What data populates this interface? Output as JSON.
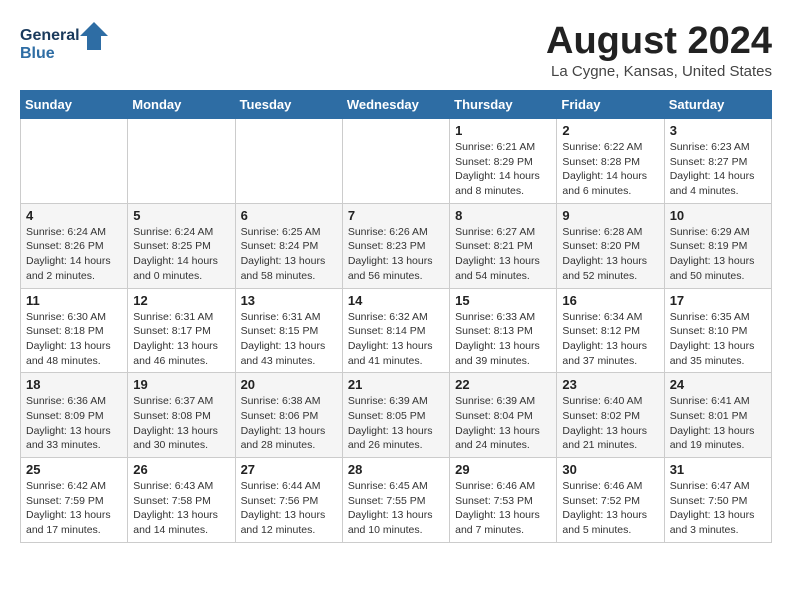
{
  "header": {
    "logo_line1": "General",
    "logo_line2": "Blue",
    "title": "August 2024",
    "subtitle": "La Cygne, Kansas, United States"
  },
  "days_of_week": [
    "Sunday",
    "Monday",
    "Tuesday",
    "Wednesday",
    "Thursday",
    "Friday",
    "Saturday"
  ],
  "weeks": [
    [
      {
        "num": "",
        "info": ""
      },
      {
        "num": "",
        "info": ""
      },
      {
        "num": "",
        "info": ""
      },
      {
        "num": "",
        "info": ""
      },
      {
        "num": "1",
        "info": "Sunrise: 6:21 AM\nSunset: 8:29 PM\nDaylight: 14 hours and 8 minutes."
      },
      {
        "num": "2",
        "info": "Sunrise: 6:22 AM\nSunset: 8:28 PM\nDaylight: 14 hours and 6 minutes."
      },
      {
        "num": "3",
        "info": "Sunrise: 6:23 AM\nSunset: 8:27 PM\nDaylight: 14 hours and 4 minutes."
      }
    ],
    [
      {
        "num": "4",
        "info": "Sunrise: 6:24 AM\nSunset: 8:26 PM\nDaylight: 14 hours and 2 minutes."
      },
      {
        "num": "5",
        "info": "Sunrise: 6:24 AM\nSunset: 8:25 PM\nDaylight: 14 hours and 0 minutes."
      },
      {
        "num": "6",
        "info": "Sunrise: 6:25 AM\nSunset: 8:24 PM\nDaylight: 13 hours and 58 minutes."
      },
      {
        "num": "7",
        "info": "Sunrise: 6:26 AM\nSunset: 8:23 PM\nDaylight: 13 hours and 56 minutes."
      },
      {
        "num": "8",
        "info": "Sunrise: 6:27 AM\nSunset: 8:21 PM\nDaylight: 13 hours and 54 minutes."
      },
      {
        "num": "9",
        "info": "Sunrise: 6:28 AM\nSunset: 8:20 PM\nDaylight: 13 hours and 52 minutes."
      },
      {
        "num": "10",
        "info": "Sunrise: 6:29 AM\nSunset: 8:19 PM\nDaylight: 13 hours and 50 minutes."
      }
    ],
    [
      {
        "num": "11",
        "info": "Sunrise: 6:30 AM\nSunset: 8:18 PM\nDaylight: 13 hours and 48 minutes."
      },
      {
        "num": "12",
        "info": "Sunrise: 6:31 AM\nSunset: 8:17 PM\nDaylight: 13 hours and 46 minutes."
      },
      {
        "num": "13",
        "info": "Sunrise: 6:31 AM\nSunset: 8:15 PM\nDaylight: 13 hours and 43 minutes."
      },
      {
        "num": "14",
        "info": "Sunrise: 6:32 AM\nSunset: 8:14 PM\nDaylight: 13 hours and 41 minutes."
      },
      {
        "num": "15",
        "info": "Sunrise: 6:33 AM\nSunset: 8:13 PM\nDaylight: 13 hours and 39 minutes."
      },
      {
        "num": "16",
        "info": "Sunrise: 6:34 AM\nSunset: 8:12 PM\nDaylight: 13 hours and 37 minutes."
      },
      {
        "num": "17",
        "info": "Sunrise: 6:35 AM\nSunset: 8:10 PM\nDaylight: 13 hours and 35 minutes."
      }
    ],
    [
      {
        "num": "18",
        "info": "Sunrise: 6:36 AM\nSunset: 8:09 PM\nDaylight: 13 hours and 33 minutes."
      },
      {
        "num": "19",
        "info": "Sunrise: 6:37 AM\nSunset: 8:08 PM\nDaylight: 13 hours and 30 minutes."
      },
      {
        "num": "20",
        "info": "Sunrise: 6:38 AM\nSunset: 8:06 PM\nDaylight: 13 hours and 28 minutes."
      },
      {
        "num": "21",
        "info": "Sunrise: 6:39 AM\nSunset: 8:05 PM\nDaylight: 13 hours and 26 minutes."
      },
      {
        "num": "22",
        "info": "Sunrise: 6:39 AM\nSunset: 8:04 PM\nDaylight: 13 hours and 24 minutes."
      },
      {
        "num": "23",
        "info": "Sunrise: 6:40 AM\nSunset: 8:02 PM\nDaylight: 13 hours and 21 minutes."
      },
      {
        "num": "24",
        "info": "Sunrise: 6:41 AM\nSunset: 8:01 PM\nDaylight: 13 hours and 19 minutes."
      }
    ],
    [
      {
        "num": "25",
        "info": "Sunrise: 6:42 AM\nSunset: 7:59 PM\nDaylight: 13 hours and 17 minutes."
      },
      {
        "num": "26",
        "info": "Sunrise: 6:43 AM\nSunset: 7:58 PM\nDaylight: 13 hours and 14 minutes."
      },
      {
        "num": "27",
        "info": "Sunrise: 6:44 AM\nSunset: 7:56 PM\nDaylight: 13 hours and 12 minutes."
      },
      {
        "num": "28",
        "info": "Sunrise: 6:45 AM\nSunset: 7:55 PM\nDaylight: 13 hours and 10 minutes."
      },
      {
        "num": "29",
        "info": "Sunrise: 6:46 AM\nSunset: 7:53 PM\nDaylight: 13 hours and 7 minutes."
      },
      {
        "num": "30",
        "info": "Sunrise: 6:46 AM\nSunset: 7:52 PM\nDaylight: 13 hours and 5 minutes."
      },
      {
        "num": "31",
        "info": "Sunrise: 6:47 AM\nSunset: 7:50 PM\nDaylight: 13 hours and 3 minutes."
      }
    ]
  ]
}
